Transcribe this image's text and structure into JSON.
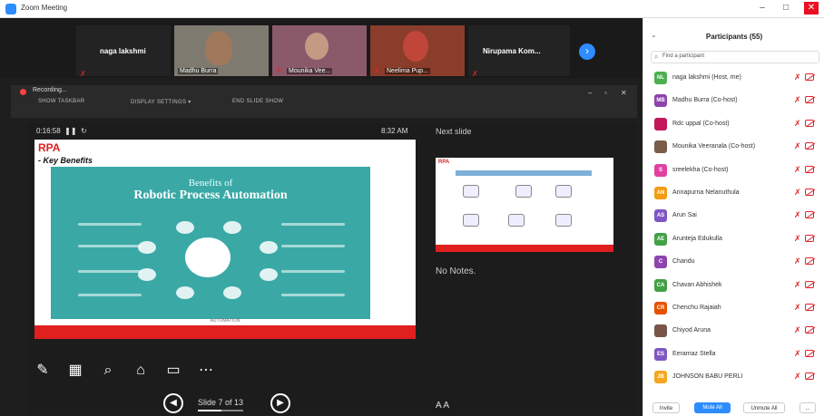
{
  "window": {
    "title": "Zoom Meeting"
  },
  "strip": {
    "tiles": [
      {
        "name": "naga lakshmi",
        "label": ""
      },
      {
        "name": "",
        "label": "Madhu Burra"
      },
      {
        "name": "",
        "label": "Mounika Vee..."
      },
      {
        "name": "",
        "label": "Neelima Pup..."
      },
      {
        "name": "Nirupama Kom...",
        "label": ""
      }
    ]
  },
  "recording": {
    "status": "Recording...",
    "tools": [
      "SHOW TASKBAR",
      "DISPLAY SETTINGS ▾",
      "END SLIDE SHOW"
    ]
  },
  "presenter": {
    "timer": "0:16:58",
    "clock": "8:32 AM",
    "next_label": "Next slide",
    "notes": "No Notes.",
    "slide_counter": "Slide 7 of 13",
    "font_buttons": "A  A"
  },
  "slide": {
    "heading": "RPA",
    "subheading": "- Key Benefits",
    "banner_line1": "Benefits of",
    "banner_line2": "Robotic Process Automation",
    "caption": "AUTOMATION"
  },
  "next_slide": {
    "heading": "RPA"
  },
  "participants": {
    "title": "Participants (55)",
    "search_placeholder": "Find a participant",
    "list": [
      {
        "initials": "NL",
        "name": "naga lakshmi (Host, me)",
        "color": "#4caf50"
      },
      {
        "initials": "MB",
        "name": "Madhu Burra (Co-host)",
        "color": "#8e44ad"
      },
      {
        "initials": "",
        "name": "Rdc uppal (Co-host)",
        "color": "#c2185b"
      },
      {
        "initials": "",
        "name": "Mounika Veeranala (Co-host)",
        "color": "#7a5c4a"
      },
      {
        "initials": "S",
        "name": "sreelekha (Co-host)",
        "color": "#e040a0"
      },
      {
        "initials": "AN",
        "name": "Annapurna Nelanuthula",
        "color": "#f39c12"
      },
      {
        "initials": "AS",
        "name": "Arun Sai",
        "color": "#7e57c2"
      },
      {
        "initials": "AE",
        "name": "Arunteja Edukulla",
        "color": "#43a047"
      },
      {
        "initials": "C",
        "name": "Chandu",
        "color": "#8e44ad"
      },
      {
        "initials": "CA",
        "name": "Chavan Abhishek",
        "color": "#43a047"
      },
      {
        "initials": "CR",
        "name": "Chenchu Rajaiah",
        "color": "#e65100"
      },
      {
        "initials": "",
        "name": "Chiyod Aruna",
        "color": "#795548"
      },
      {
        "initials": "ES",
        "name": "Eeramaz Stella",
        "color": "#7e57c2"
      },
      {
        "initials": "JB",
        "name": "JOHNSON BABU PERLI",
        "color": "#f5a623"
      }
    ],
    "footer": {
      "invite": "Invite",
      "mute_all": "Mute All",
      "unmute_all": "Unmute All",
      "more": "..."
    }
  }
}
